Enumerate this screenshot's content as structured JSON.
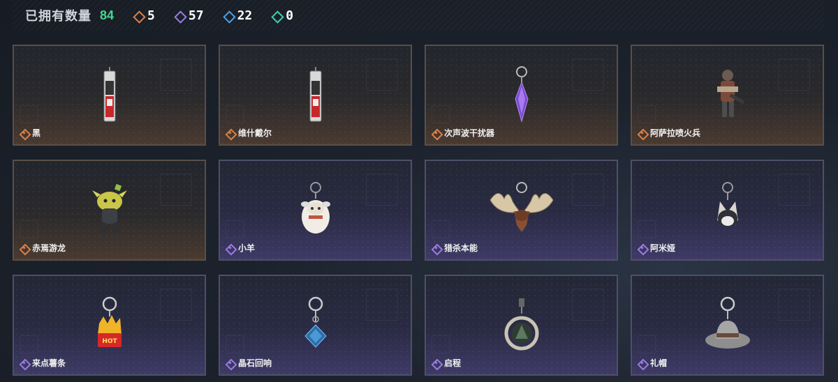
{
  "header": {
    "owned_label": "已拥有数量",
    "owned_count": "84",
    "stats": [
      {
        "icon": "orange-diamond-icon",
        "color": "#d9804a",
        "value": "5"
      },
      {
        "icon": "purple-diamond-icon",
        "color": "#9a7be0",
        "value": "57"
      },
      {
        "icon": "blue-diamond-icon",
        "color": "#4c9fe6",
        "value": "22"
      },
      {
        "icon": "green-diamond-icon",
        "color": "#3fd0b0",
        "value": "0"
      }
    ]
  },
  "items": [
    {
      "name": "黑",
      "rarity": "orange",
      "art": "card"
    },
    {
      "name": "维什戴尔",
      "rarity": "orange",
      "art": "card"
    },
    {
      "name": "次声波干扰器",
      "rarity": "orange",
      "art": "crystal"
    },
    {
      "name": "阿萨拉喷火兵",
      "rarity": "orange",
      "art": "figure"
    },
    {
      "name": "赤焉游龙",
      "rarity": "orange",
      "art": "dragon"
    },
    {
      "name": "小羊",
      "rarity": "purple",
      "art": "sheep"
    },
    {
      "name": "猎杀本能",
      "rarity": "purple",
      "art": "moose"
    },
    {
      "name": "阿米娅",
      "rarity": "purple",
      "art": "bunny"
    },
    {
      "name": "来点薯条",
      "rarity": "purple",
      "art": "fries"
    },
    {
      "name": "晶石回响",
      "rarity": "purple",
      "art": "gem"
    },
    {
      "name": "启程",
      "rarity": "purple",
      "art": "ring"
    },
    {
      "name": "礼帽",
      "rarity": "purple",
      "art": "hat"
    }
  ]
}
